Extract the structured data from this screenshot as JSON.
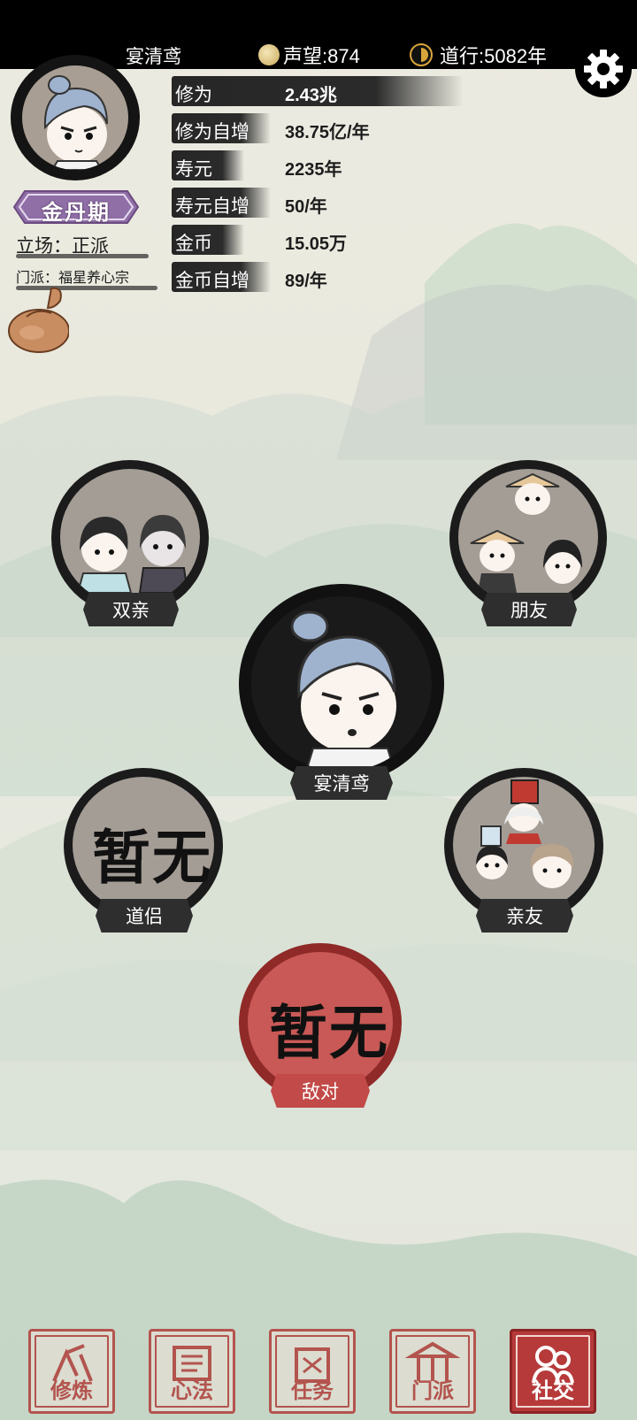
{
  "header": {
    "player_name": "宴清鸢",
    "reputation": "声望:874",
    "daoxing": "道行:5082年"
  },
  "profile": {
    "rank": "金丹期",
    "stance": "立场：正派",
    "sect": "门派：福星养心宗"
  },
  "stats": [
    {
      "label": "修为",
      "value": "2.43兆"
    },
    {
      "label": "修为自增",
      "value": "38.75亿/年"
    },
    {
      "label": "寿元",
      "value": "2235年"
    },
    {
      "label": "寿元自增",
      "value": "50/年"
    },
    {
      "label": "金币",
      "value": "15.05万"
    },
    {
      "label": "金币自增",
      "value": "89/年"
    }
  ],
  "relations": {
    "parents": "双亲",
    "friends": "朋友",
    "self": "宴清鸢",
    "partner": "道侣",
    "partner_empty": "暂无",
    "relatives": "亲友",
    "enemy": "敌对",
    "enemy_empty": "暂无"
  },
  "nav": [
    {
      "label": "修炼",
      "icon": "cultivate-icon"
    },
    {
      "label": "心法",
      "icon": "scroll-icon"
    },
    {
      "label": "任务",
      "icon": "task-icon"
    },
    {
      "label": "门派",
      "icon": "sect-icon"
    },
    {
      "label": "社交",
      "icon": "social-icon",
      "active": true
    }
  ],
  "colors": {
    "accent_red": "#b63a3a",
    "stamp_red": "#b3544e",
    "ink": "#1b1b1b"
  }
}
